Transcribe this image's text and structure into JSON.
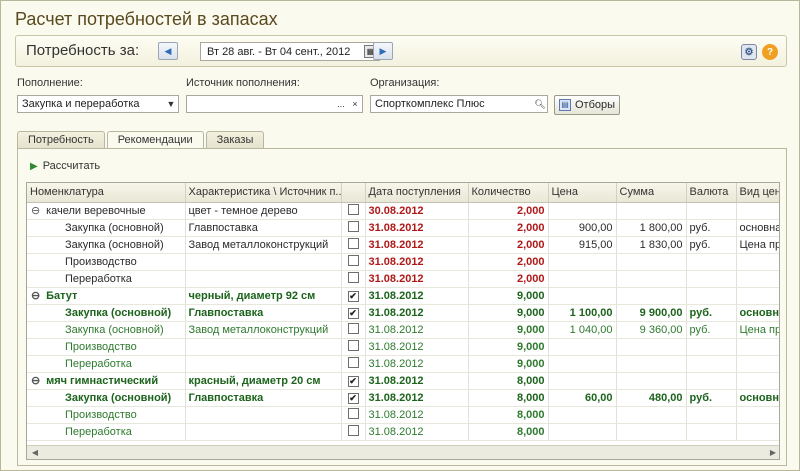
{
  "title": "Расчет потребностей в запасах",
  "period": {
    "label": "Потребность за:",
    "value": "Вт 28 авг. - Вт 04 сент., 2012",
    "prev_icon": "arrow-left-icon",
    "next_icon": "arrow-right-icon"
  },
  "filters": {
    "replenishment_label": "Пополнение:",
    "replenishment_value": "Закупка и переработка",
    "source_label": "Источник пополнения:",
    "source_value": "",
    "source_clear": "×",
    "source_select": "...",
    "org_label": "Организация:",
    "org_value": "Спорткомплекс Плюс",
    "selections_button": "Отборы"
  },
  "tabs": [
    {
      "label": "Потребность"
    },
    {
      "label": "Рекомендации",
      "active": true
    },
    {
      "label": "Заказы"
    }
  ],
  "calculate_button": "Рассчитать",
  "columns": [
    "Номенклатура",
    "Характеристика \\ Источник п...",
    "",
    "Дата поступления",
    "Количество",
    "Цена",
    "Сумма",
    "Валюта",
    "Вид цен"
  ],
  "rows": [
    {
      "style": "normal",
      "level": 0,
      "expander": "⊖",
      "name": "качели веревочные",
      "char": "цвет - темное дерево",
      "checked": false,
      "date": "30.08.2012",
      "date_red": true,
      "qty": "2,000",
      "qty_red": true,
      "price": "",
      "sum": "",
      "currency": "",
      "price_type": ""
    },
    {
      "style": "normal",
      "level": 1,
      "expander": "",
      "name": "Закупка (основной)",
      "char": "Главпоставка",
      "checked": false,
      "date": "31.08.2012",
      "date_red": true,
      "qty": "2,000",
      "qty_red": true,
      "price": "900,00",
      "sum": "1 800,00",
      "currency": "руб.",
      "price_type": "основна"
    },
    {
      "style": "normal",
      "level": 1,
      "expander": "",
      "name": "Закупка (основной)",
      "char": "Завод металлоконструкций",
      "checked": false,
      "date": "31.08.2012",
      "date_red": true,
      "qty": "2,000",
      "qty_red": true,
      "price": "915,00",
      "sum": "1 830,00",
      "currency": "руб.",
      "price_type": "Цена пра"
    },
    {
      "style": "normal",
      "level": 1,
      "expander": "",
      "name": "Производство",
      "char": "",
      "checked": false,
      "date": "31.08.2012",
      "date_red": true,
      "qty": "2,000",
      "qty_red": true,
      "price": "",
      "sum": "",
      "currency": "",
      "price_type": ""
    },
    {
      "style": "normal",
      "level": 1,
      "expander": "",
      "name": "Переработка",
      "char": "",
      "checked": false,
      "date": "31.08.2012",
      "date_red": true,
      "qty": "2,000",
      "qty_red": true,
      "price": "",
      "sum": "",
      "currency": "",
      "price_type": ""
    },
    {
      "style": "greenbold",
      "level": 0,
      "expander": "⊖",
      "name": "Батут",
      "char": "черный, диаметр 92 см",
      "checked": true,
      "date": "31.08.2012",
      "date_red": false,
      "qty": "9,000",
      "qty_red": false,
      "price": "",
      "sum": "",
      "currency": "",
      "price_type": ""
    },
    {
      "style": "greenbold",
      "level": 1,
      "expander": "",
      "name": "Закупка (основной)",
      "char": "Главпоставка",
      "checked": true,
      "date": "31.08.2012",
      "date_red": false,
      "qty": "9,000",
      "qty_red": true,
      "price": "1 100,00",
      "sum": "9 900,00",
      "currency": "руб.",
      "price_type": "основна"
    },
    {
      "style": "green",
      "level": 1,
      "expander": "",
      "name": "Закупка (основной)",
      "char": "Завод металлоконструкций",
      "checked": false,
      "date": "31.08.2012",
      "date_red": false,
      "qty": "9,000",
      "qty_red": true,
      "price": "1 040,00",
      "sum": "9 360,00",
      "currency": "руб.",
      "price_type": "Цена пра"
    },
    {
      "style": "green",
      "level": 1,
      "expander": "",
      "name": "Производство",
      "char": "",
      "checked": false,
      "date": "31.08.2012",
      "date_red": false,
      "qty": "9,000",
      "qty_red": true,
      "price": "",
      "sum": "",
      "currency": "",
      "price_type": ""
    },
    {
      "style": "green",
      "level": 1,
      "expander": "",
      "name": "Переработка",
      "char": "",
      "checked": false,
      "date": "31.08.2012",
      "date_red": false,
      "qty": "9,000",
      "qty_red": true,
      "price": "",
      "sum": "",
      "currency": "",
      "price_type": ""
    },
    {
      "style": "greenbold",
      "level": 0,
      "expander": "⊖",
      "name": "мяч гимнастический",
      "char": "красный, диаметр 20 см",
      "checked": true,
      "date": "31.08.2012",
      "date_red": false,
      "qty": "8,000",
      "qty_red": false,
      "price": "",
      "sum": "",
      "currency": "",
      "price_type": ""
    },
    {
      "style": "greenbold",
      "level": 1,
      "expander": "",
      "name": "Закупка (основной)",
      "char": "Главпоставка",
      "checked": true,
      "date": "31.08.2012",
      "date_red": false,
      "qty": "8,000",
      "qty_red": true,
      "price": "60,00",
      "sum": "480,00",
      "currency": "руб.",
      "price_type": "основна"
    },
    {
      "style": "green",
      "level": 1,
      "expander": "",
      "name": "Производство",
      "char": "",
      "checked": false,
      "date": "31.08.2012",
      "date_red": false,
      "qty": "8,000",
      "qty_red": true,
      "price": "",
      "sum": "",
      "currency": "",
      "price_type": ""
    },
    {
      "style": "green",
      "level": 1,
      "expander": "",
      "name": "Переработка",
      "char": "",
      "checked": false,
      "date": "31.08.2012",
      "date_red": false,
      "qty": "8,000",
      "qty_red": true,
      "price": "",
      "sum": "",
      "currency": "",
      "price_type": ""
    }
  ],
  "colors": {
    "red": "#b01818",
    "green": "#2e7a2e",
    "accent": "#2d6db5"
  }
}
